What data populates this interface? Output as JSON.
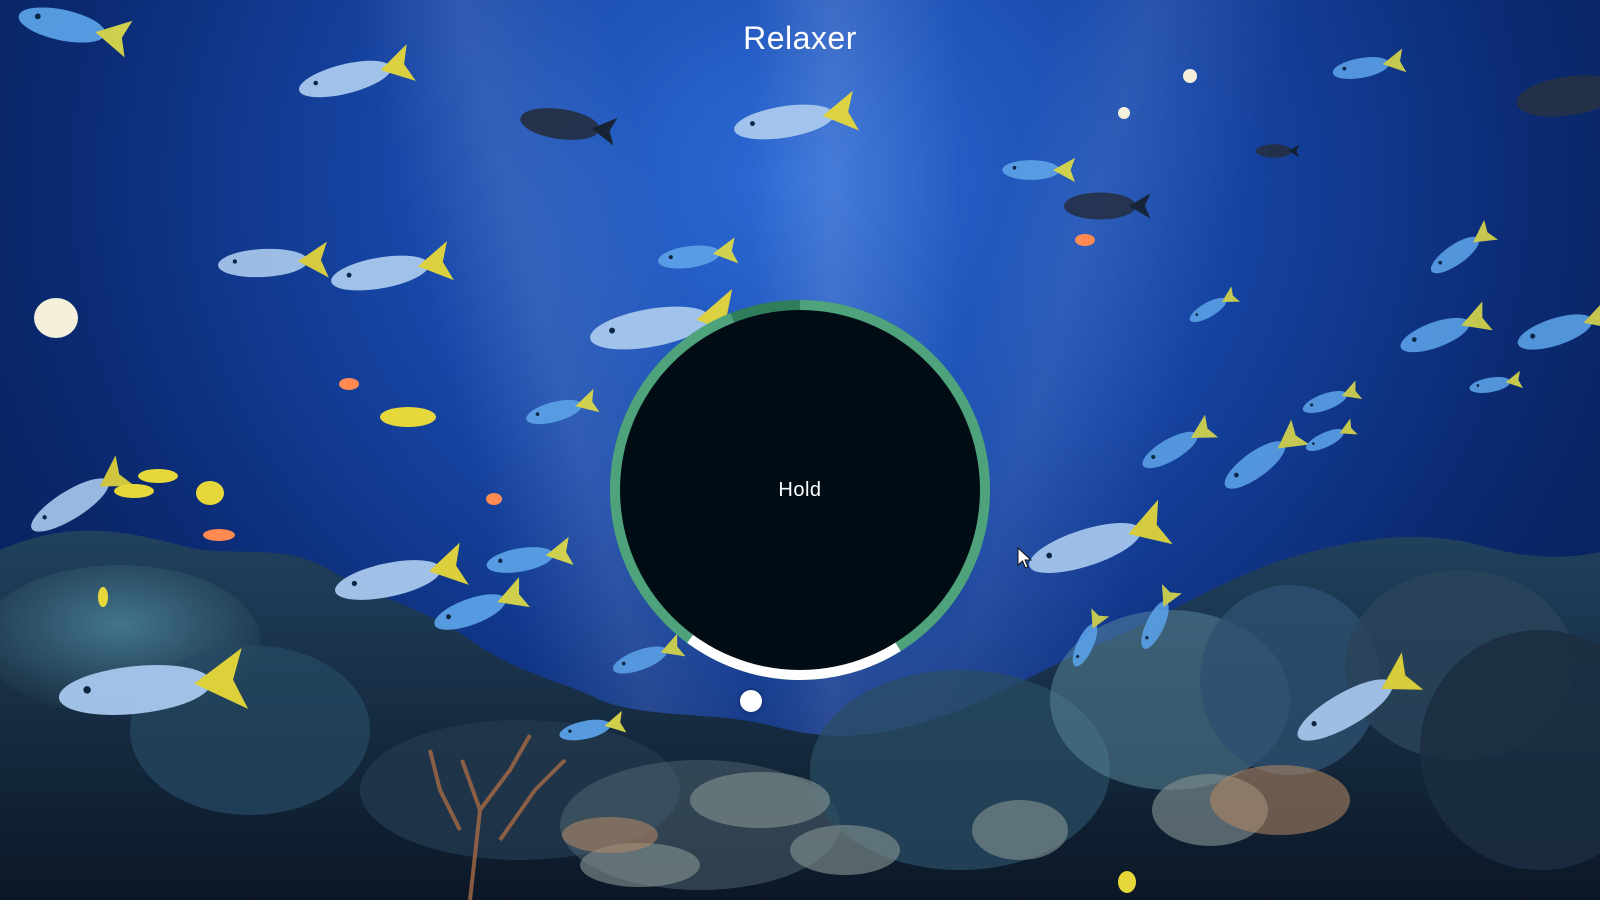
{
  "app": {
    "title": "Relaxer"
  },
  "timer": {
    "label": "Hold",
    "progress_fraction": 0.19,
    "colors": {
      "ring_base": "#4ea37c",
      "ring_dark": "#2f7d5b",
      "ring_progress": "#ffffff",
      "core": "#020c14"
    }
  },
  "background": {
    "scene": "aquarium",
    "colors": {
      "water_light": "#2d6bd6",
      "water_mid": "#1747a8",
      "water_dark": "#061a45",
      "fish_body": "#a8c8ee",
      "fish_tail": "#e6d83a"
    }
  },
  "icons": {
    "pointer": "white-dot",
    "cursor": "arrow-cursor"
  }
}
